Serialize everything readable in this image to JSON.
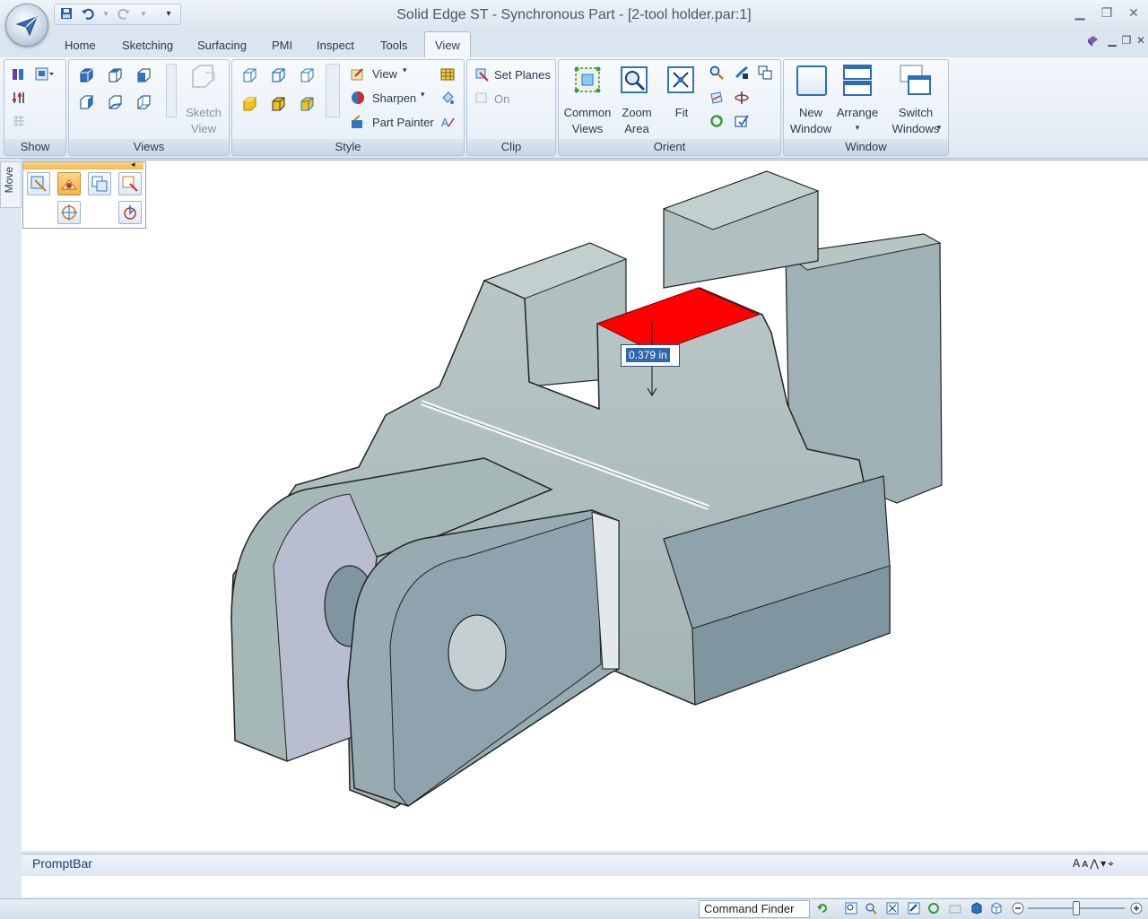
{
  "window": {
    "title": "Solid Edge ST - Synchronous Part - [2-tool holder.par:1]"
  },
  "tabs": [
    "Home",
    "Sketching",
    "Surfacing",
    "PMI",
    "Inspect",
    "Tools",
    "View"
  ],
  "active_tab": "View",
  "ribbon": {
    "show": {
      "label": "Show"
    },
    "views": {
      "label": "Views",
      "sketch_view": [
        "Sketch",
        "View"
      ]
    },
    "style": {
      "label": "Style",
      "view": "View",
      "sharpen": "Sharpen",
      "part_painter": "Part Painter"
    },
    "clip": {
      "label": "Clip",
      "set_planes": "Set Planes",
      "on": "On"
    },
    "orient": {
      "label": "Orient",
      "common_views": [
        "Common",
        "Views"
      ],
      "zoom_area": [
        "Zoom",
        "Area"
      ],
      "fit": "Fit"
    },
    "window": {
      "label": "Window",
      "new_window": [
        "New",
        "Window"
      ],
      "arrange": "Arrange",
      "switch_windows": [
        "Switch",
        "Windows"
      ]
    }
  },
  "side_tab": "Move",
  "dimension": "0.379 in",
  "promptbar": {
    "title": "PromptBar"
  },
  "statusbar": {
    "command_finder": "Command Finder"
  },
  "colors": {
    "selected_face": "#ff0000",
    "model": "#a5b5b5",
    "accent": "#2d6fb6"
  },
  "icons": [
    "save-icon",
    "undo-icon",
    "redo-icon",
    "view-cube-icon",
    "shaded-icon",
    "zoom-icon",
    "fit-icon",
    "window-icon"
  ]
}
